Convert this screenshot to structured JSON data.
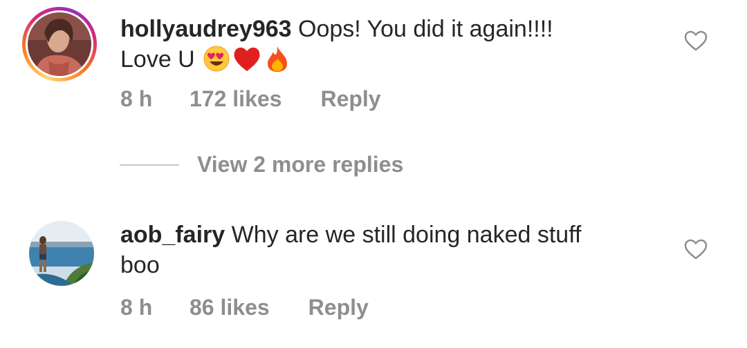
{
  "comments": [
    {
      "username": "hollyaudrey963",
      "text_line1": " Oops! You did it again!!!!",
      "text_line2": "Love U ",
      "emojis": [
        "heart-eyes-emoji",
        "red-heart-emoji",
        "fire-emoji"
      ],
      "time": "8 h",
      "likes": "172 likes",
      "reply_label": "Reply",
      "has_story_ring": true
    },
    {
      "username": "aob_fairy",
      "text_line1": " Why are we still doing naked stuff",
      "text_line2": "boo",
      "time": "8 h",
      "likes": "86 likes",
      "reply_label": "Reply",
      "has_story_ring": false
    }
  ],
  "view_more_replies": "View 2 more replies",
  "icons": {
    "like": "heart-outline-icon"
  },
  "colors": {
    "text": "#262626",
    "secondary": "#8e8e8e",
    "divider": "#c7c7c7"
  }
}
